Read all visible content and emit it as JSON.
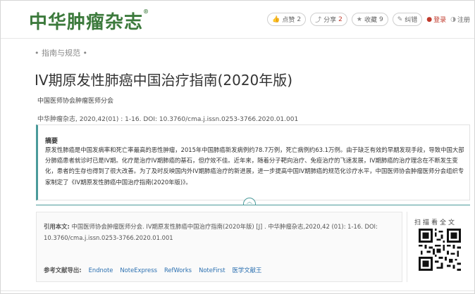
{
  "header": {
    "logo_text": "中华肿瘤杂志",
    "logo_mark": "®",
    "actions": {
      "like_label": "点赞",
      "like_count": "2",
      "share_label": "分享",
      "share_count": "2",
      "favorite_label": "收藏",
      "favorite_count": "9",
      "correction_label": "纠错",
      "login_label": "登录",
      "register_label": "注册"
    }
  },
  "article": {
    "section": "• 指南与规范 •",
    "title": "IV期原发性肺癌中国治疗指南(2020年版)",
    "author": "中国医师协会肿瘤医师分会",
    "citation_line": "中华肿瘤杂志, 2020,42(01) : 1-16. DOI: 10.3760/cma.j.issn.0253-3766.2020.01.001",
    "abstract_title": "摘要",
    "abstract_text": "原发性肺癌是中国发病率和死亡率最高的恶性肿瘤，2015年中国肺癌新发病例约78.7万例，死亡病例约63.1万例。由于缺乏有效的早期发现手段，导致中国大部分肺癌患者就诊时已是IV期。化疗是治疗IV期肺癌的基石，但疗效不佳。近年来，随着分子靶向治疗、免疫治疗的飞速发展，IV期肺癌的治疗理念在不断发生变化，患者的生存也得到了很大改善。为了及时反映国内外IV期肺癌治疗的新进展，进一步提高中国IV期肺癌的规范化诊疗水平，中国医师协会肿瘤医师分会组织专家制定了《IV期原发性肺癌中国治疗指南(2020年版)》。"
  },
  "cite": {
    "label": "引用本文:",
    "text": " 中国医师协会肿瘤医师分会. IV期原发性肺癌中国治疗指南(2020年版) [J] . 中华肿瘤杂志,2020,42 (01): 1-16. DOI: 10.3760/cma.j.issn.0253-3766.2020.01.001",
    "export_label": "参考文献导出:",
    "export_formats": [
      "Endnote",
      "NoteExpress",
      "RefWorks",
      "NoteFirst",
      "医学文献王"
    ]
  },
  "qr": {
    "label": "扫描看全文"
  }
}
